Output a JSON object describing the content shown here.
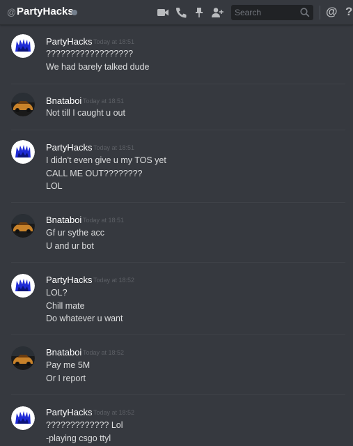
{
  "header": {
    "at_symbol": "@",
    "dm_name": "PartyHacks",
    "search_placeholder": "Search",
    "mention_glyph": "@",
    "help_glyph": "?"
  },
  "icons": [
    "video-call-icon",
    "voice-call-icon",
    "pin-icon",
    "add-friend-icon",
    "search-icon",
    "mention-icon",
    "help-icon"
  ],
  "messages": [
    {
      "author": "PartyHacks",
      "time": "Today at 18:51",
      "lines": [
        "??????????????????",
        "We had barely talked dude"
      ]
    },
    {
      "author": "Bnataboi",
      "time": "Today at 18:51",
      "lines": [
        "Not till I caught u out"
      ]
    },
    {
      "author": "PartyHacks",
      "time": "Today at 18:51",
      "lines": [
        "I didn't even give u my TOS yet",
        "CALL ME OUT????????",
        "LOL"
      ]
    },
    {
      "author": "Bnataboi",
      "time": "Today at 18:51",
      "lines": [
        "Gf ur sythe acc",
        "U and ur bot"
      ]
    },
    {
      "author": "PartyHacks",
      "time": "Today at 18:52",
      "lines": [
        "LOL?",
        "Chill mate",
        "Do whatever u want"
      ]
    },
    {
      "author": "Bnataboi",
      "time": "Today at 18:52",
      "lines": [
        "Pay me 5M",
        "Or I report"
      ]
    },
    {
      "author": "PartyHacks",
      "time": "Today at 18:52",
      "lines": [
        "????????????? Lol",
        "-playing csgo ttyl"
      ]
    }
  ],
  "colors": {
    "background": "#36393f",
    "header_text": "#ffffff",
    "body_text": "#dcddde",
    "timestamp": "#5d6066",
    "avatar_partyhacks": "#1f2bd6",
    "avatar_bnataboi": "#c8822a"
  }
}
